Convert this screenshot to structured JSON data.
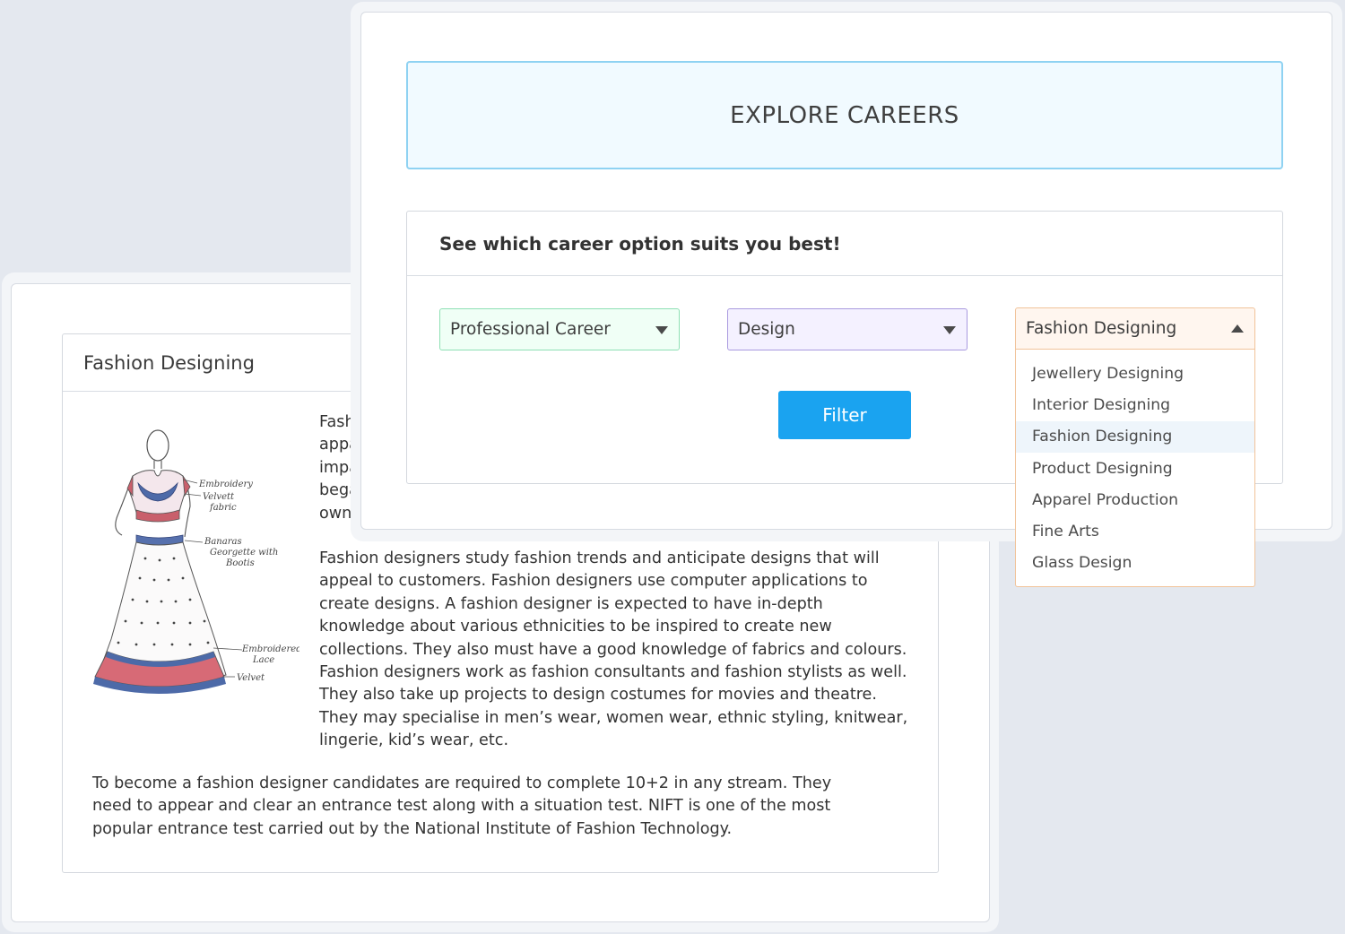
{
  "explore": {
    "title": "EXPLORE CAREERS",
    "subtitle": "See which career option suits you best!",
    "selects": {
      "career_type": "Professional Career",
      "stream": "Design",
      "course": "Fashion Designing"
    },
    "dropdown_options": [
      "Jewellery Designing",
      "Interior Designing",
      "Fashion Designing",
      "Product Designing",
      "Apparel Production",
      "Fine Arts",
      "Glass Design"
    ],
    "selected_option": "Fashion Designing",
    "filter_label": "Filter"
  },
  "detail": {
    "title": "Fashion Designing",
    "intro_fragment": "Fashi\nappa\nimpa\nbega\nown",
    "paragraph": "Fashion designers study fashion trends and anticipate designs that will appeal to customers. Fashion designers use computer applications to create designs. A fashion designer is expected to have in-depth knowledge about various ethnicities to be inspired to create new collections. They also must have a good knowledge of fabrics and colours. Fashion designers work as fashion consultants and fashion stylists as well. They also take up projects to design costumes for movies and theatre. They may specialise in men’s wear, women wear, ethnic styling, knitwear, lingerie, kid’s wear, etc.",
    "footer": "To become a fashion designer candidates are required to complete 10+2 in any stream. They need to appear and clear an entrance test along with a situation test. NIFT is one of the most popular entrance test carried out by the National Institute of Fashion Technology.",
    "sketch_labels": {
      "embroidery": "Embroidery",
      "velvet_fabric": "Velvett fabric",
      "banaras": "Banaras Georgette with Bootis",
      "embroidered_lace": "Embroidered Lace",
      "velvet": "Velvet"
    }
  },
  "colors": {
    "accent_blue": "#1aa3f0",
    "hero_border": "#8fd2f2",
    "career_border": "#8ee0b4",
    "stream_border": "#a99adf",
    "course_border": "#f1c39a"
  }
}
